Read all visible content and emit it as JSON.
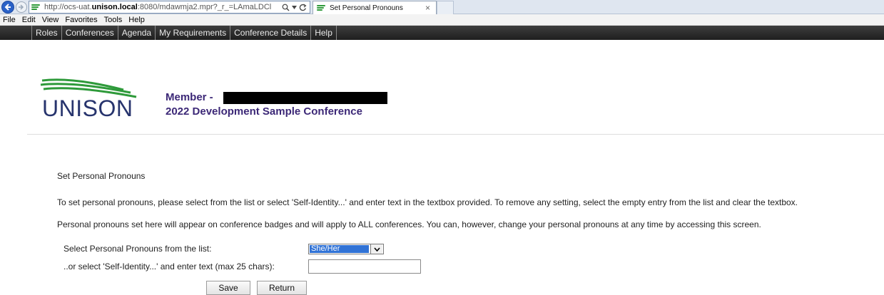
{
  "browser": {
    "url_prefix": "http://ocs-uat.",
    "url_host_bold": "unison.local",
    "url_rest": ":8080/mdawmja2.mpr?_r_=LAmaLDCl",
    "tab_title": "Set Personal Pronouns",
    "tab_close": "×"
  },
  "menu": {
    "file": "File",
    "edit": "Edit",
    "view": "View",
    "favorites": "Favorites",
    "tools": "Tools",
    "help": "Help"
  },
  "nav": {
    "items": [
      "Roles",
      "Conferences",
      "Agenda",
      "My Requirements",
      "Conference Details",
      "Help"
    ]
  },
  "header": {
    "logo_text": "UNISON",
    "member_label": "Member -",
    "conference_title": "2022 Development Sample Conference"
  },
  "main": {
    "heading": "Set Personal Pronouns",
    "intro1": "To set personal pronouns, please select from the list or select 'Self-Identity...' and enter text in the textbox provided. To remove any setting, select the empty entry from the list and clear the textbox.",
    "intro2": "Personal pronouns set here will appear on conference badges and will apply to ALL conferences. You can, however, change your personal pronouns at any time by accessing this screen.",
    "select_label": "Select Personal Pronouns from the list:",
    "self_identity_label": "..or select 'Self-Identity...' and enter text (max 25 chars):",
    "select_value": "She/Her",
    "self_identity_value": "",
    "save_label": "Save",
    "return_label": "Return"
  },
  "colors": {
    "nav_bg": "#2b2b2b",
    "brand_purple": "#3c2877",
    "logo_navy": "#27346d",
    "logo_green": "#2e9a3a",
    "select_highlight": "#3173d6"
  }
}
